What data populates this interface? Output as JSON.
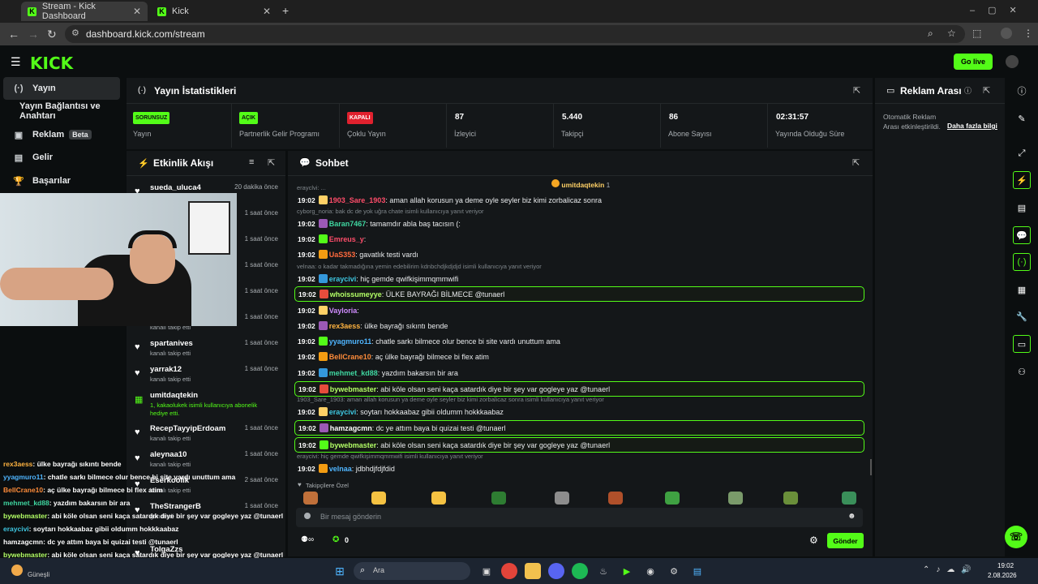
{
  "browser": {
    "tabs": [
      {
        "label": "Stream - Kick Dashboard"
      },
      {
        "label": "Kick"
      }
    ],
    "url": "dashboard.kick.com/stream"
  },
  "header": {
    "logo": "KICK",
    "go_live": "Go live"
  },
  "sidebar": {
    "items": [
      {
        "label": "Yayın"
      },
      {
        "label": "Yayın Bağlantısı ve Anahtarı"
      },
      {
        "label": "Reklam",
        "badge": "Beta"
      },
      {
        "label": "Gelir"
      },
      {
        "label": "Başarılar"
      }
    ]
  },
  "stats": {
    "title": "Yayın İstatistikleri",
    "cards": [
      {
        "badge": "SORUNSUZ",
        "label": "Yayın"
      },
      {
        "badge": "AÇIK",
        "label": "Partnerlik Gelir Programı"
      },
      {
        "badge": "KAPALI",
        "label": "Çoklu Yayın"
      },
      {
        "value": "87",
        "label": "İzleyici"
      },
      {
        "value": "5.440",
        "label": "Takipçi"
      },
      {
        "value": "86",
        "label": "Abone Sayısı"
      },
      {
        "value": "02:31:57",
        "label": "Yayında Olduğu Süre"
      }
    ]
  },
  "ads": {
    "title": "Reklam Arası",
    "text": "Otomatik Reklam Arası etkinleştirildi.",
    "link": "Daha fazla bilgi"
  },
  "activity": {
    "title": "Etkinlik Akışı",
    "items": [
      {
        "name": "sueda_uluca4",
        "time": "20 dakika önce",
        "sub": ""
      },
      {
        "name": "",
        "time": "1 saat önce",
        "sub": ""
      },
      {
        "name": "",
        "time": "1 saat önce",
        "sub": ""
      },
      {
        "name": "",
        "time": "1 saat önce",
        "sub": ""
      },
      {
        "name": "",
        "time": "1 saat önce",
        "sub": ""
      },
      {
        "name": "",
        "time": "1 saat önce",
        "sub": "kanalı takip etti"
      },
      {
        "name": "spartanives",
        "time": "1 saat önce",
        "sub": "kanalı takip etti"
      },
      {
        "name": "yarrak12",
        "time": "1 saat önce",
        "sub": "kanalı takip etti"
      },
      {
        "name": "umitdaqtekin",
        "time": "",
        "sub": "1, kakaolukek isimli kullanıcıya abonelik hediye etti."
      },
      {
        "name": "RecepTayyipErdoam",
        "time": "1 saat önce",
        "sub": "kanalı takip etti"
      },
      {
        "name": "aleynaa10",
        "time": "1 saat önce",
        "sub": "kanalı takip etti"
      },
      {
        "name": "Eserkoolik",
        "time": "2 saat önce",
        "sub": "kanalı takip etti"
      },
      {
        "name": "TheStrangerB",
        "time": "1 saat önce",
        "sub": "gönderdi"
      },
      {
        "name": "TolgaZzs",
        "time": "",
        "sub": ""
      }
    ]
  },
  "chat": {
    "title": "Sohbet",
    "pinned_user": "umitdaqtekin",
    "pinned_count": "1",
    "messages": [
      {
        "time": "19:02",
        "user": "1903_Sare_1903",
        "text": ": aman allah korusun ya deme oyle seyler biz kimi zorbalicaz sonra",
        "color": "#ff4d6a",
        "hl": false,
        "reply": "erayclvi: ..."
      },
      {
        "time": "19:02",
        "user": "Baran7467",
        "text": ": tamamdır abla baş tacısın (:",
        "color": "#3fd6a0",
        "hl": false,
        "reply": "cyborg_noria: bak dc de yok uğra chate isimli kullanıcıya yanıt veriyor"
      },
      {
        "time": "19:02",
        "user": "Emreus_y",
        "text": ":",
        "color": "#ff4d6a",
        "hl": false,
        "reply": ""
      },
      {
        "time": "19:02",
        "user": "UaS353",
        "text": ": gavatlık testi vardı",
        "color": "#ff6a3d",
        "hl": false,
        "reply": ""
      },
      {
        "time": "19:02",
        "user": "eraycivi",
        "text": ": hiç gemde qwifkişimmqmmwifi",
        "color": "#3ec6e0",
        "hl": false,
        "reply": "velnaa: o kadar takmadığına yemin edebilirim kdnbchdjkdjdjd isimli kullanıcıya yanıt veriyor"
      },
      {
        "time": "19:02",
        "user": "whoissumeyye",
        "text": ": ÜLKE BAYRAĞI BİLMECE @tunaerl",
        "color": "#b3ff66",
        "hl": true,
        "reply": ""
      },
      {
        "time": "19:02",
        "user": "Vayloria",
        "text": ":",
        "color": "#d08cff",
        "hl": false,
        "reply": ""
      },
      {
        "time": "19:02",
        "user": "rex3aess",
        "text": ": ülke bayrağı sıkıntı bende",
        "color": "#ffb340",
        "hl": false,
        "reply": ""
      },
      {
        "time": "19:02",
        "user": "yyagmuro11",
        "text": ": chatle sarkı bilmece olur bence bi site vardı unuttum ama",
        "color": "#4fb5ff",
        "hl": false,
        "reply": ""
      },
      {
        "time": "19:02",
        "user": "BellCrane10",
        "text": ": aç ülke bayrağı bilmece bi flex atim",
        "color": "#ff8c3a",
        "hl": false,
        "reply": ""
      },
      {
        "time": "19:02",
        "user": "mehmet_kd88",
        "text": ": yazdım bakarsın bir ara",
        "color": "#3fd6a0",
        "hl": false,
        "reply": ""
      },
      {
        "time": "19:02",
        "user": "bywebmaster",
        "text": ": abi köle olsan seni kaça satardık diye bir şey var gogleye yaz @tunaerl",
        "color": "#b3ff66",
        "hl": true,
        "reply": ""
      },
      {
        "time": "19:02",
        "user": "eraycivi",
        "text": ": soytarı hokkaabaz gibii oldumm hokkkaabaz",
        "color": "#3ec6e0",
        "hl": false,
        "reply": "1903_Sare_1903: aman allah korusun ya deme oyle seyler biz kimi zorbalicaz sonra isimli kullanıcıya yanıt veriyor"
      },
      {
        "time": "19:02",
        "user": "hamzagcmn",
        "text": ": dc ye attım baya bi quizai testi @tunaerl",
        "color": "#ffffff",
        "hl": true,
        "reply": ""
      },
      {
        "time": "19:02",
        "user": "bywebmaster",
        "text": ": abi köle olsan seni kaça satardık diye bir şey var gogleye yaz @tunaerl",
        "color": "#b3ff66",
        "hl": true,
        "reply": ""
      },
      {
        "time": "19:02",
        "user": "velnaa",
        "text": ": jdbhdjfdjfdid",
        "color": "#4fb5ff",
        "hl": false,
        "reply": "eraycivi: hiç gemde qwifkişimmqmmwifi isimli kullanıcıya yanıt veriyor"
      }
    ],
    "emote_label": "Takipçilere Özel",
    "input_placeholder": "Bir mesaj gönderin",
    "send": "Gönder",
    "count": "0"
  },
  "overlay": [
    {
      "user": "rex3aess",
      "text": ": ülke bayrağı sıkıntı bende",
      "color": "#ffb340"
    },
    {
      "user": "yyagmuro11",
      "text": ": chatle sarkı bilmece olur bence bi site vardı unuttum ama",
      "color": "#4fb5ff"
    },
    {
      "user": "BellCrane10",
      "text": ": aç ülke bayrağı bilmece bi flex atim",
      "color": "#ff8c3a"
    },
    {
      "user": "mehmet_kd88",
      "text": ": yazdım bakarsın bir ara",
      "color": "#3fd6a0"
    },
    {
      "user": "bywebmaster",
      "text": ": abi köle olsan seni kaça satardık diye bir şey var gogleye yaz @tunaerl",
      "color": "#b3ff66"
    },
    {
      "user": "eraycivi",
      "text": ": soytarı hokkaabaz gibii oldumm hokkkaabaz",
      "color": "#3ec6e0"
    },
    {
      "user": "hamzagcmn",
      "text": ": dc ye attım baya bi quizai testi @tunaerl",
      "color": "#ffffff"
    },
    {
      "user": "bywebmaster",
      "text": ": abi köle olsan seni kaça satardık diye bir şey var gogleye yaz @tunaerl",
      "color": "#b3ff66"
    },
    {
      "user": "velnaa",
      "text": ": jdbhdjfdjfdid",
      "color": "#4fb5ff"
    }
  ],
  "taskbar": {
    "weather": "Güneşli",
    "search": "Ara",
    "time": "19:02",
    "date": "2.08.2026"
  }
}
